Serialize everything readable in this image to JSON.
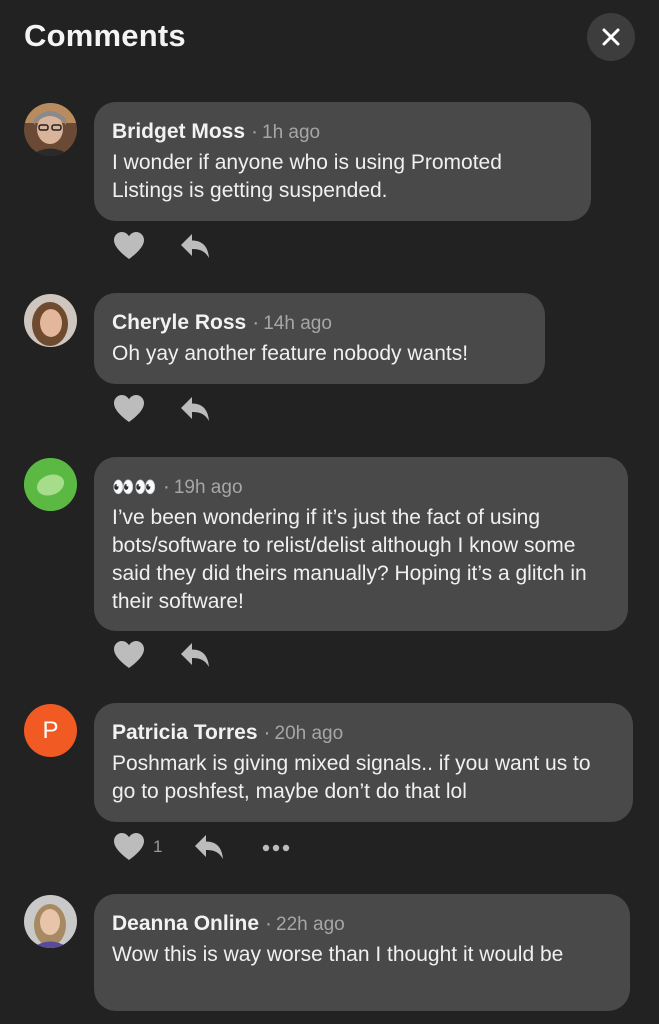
{
  "header": {
    "title": "Comments"
  },
  "comments": [
    {
      "author": "Bridget Moss",
      "time": "1h ago",
      "text": "I wonder if anyone who is using Promoted Listings is getting suspended."
    },
    {
      "author": "Cheryle Ross",
      "time": "14h ago",
      "text": "Oh yay another feature nobody wants!"
    },
    {
      "author": "👀👀",
      "time": "19h ago",
      "text": "I’ve been wondering if it’s just the fact of using bots/software to relist/delist although I know some said they did theirs manually? Hoping it’s a glitch in their software!"
    },
    {
      "author": "Patricia Torres",
      "time": "20h ago",
      "text": "Poshmark is giving mixed signals.. if you want us to go to poshfest, maybe don’t do that lol",
      "avatar_letter": "P",
      "like_count": "1"
    },
    {
      "author": "Deanna Online",
      "time": "22h ago",
      "text": "Wow this is way worse than I thought it would be"
    }
  ],
  "colors": {
    "background": "#222222",
    "bubble": "#494949",
    "patricia_avatar": "#f15a22",
    "green_avatar": "#5bb843"
  }
}
